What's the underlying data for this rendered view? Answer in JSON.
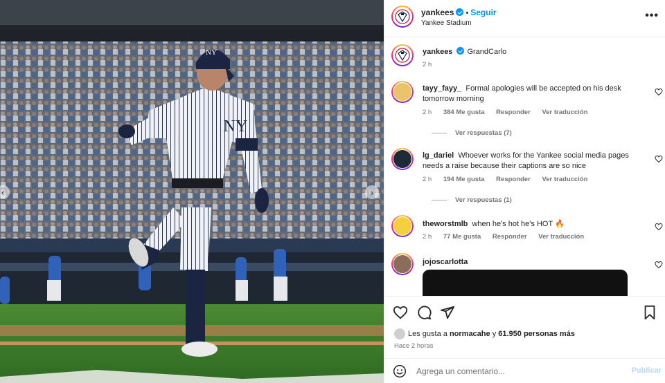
{
  "header": {
    "username": "yankees",
    "follow_label": "Seguir",
    "dot": "•",
    "location": "Yankee Stadium",
    "more_label": "•••"
  },
  "caption": {
    "username": "yankees",
    "text": "GrandCarlo",
    "time": "2 h"
  },
  "comments": [
    {
      "username": "tayy_fayy_",
      "text": "Formal apologies will be accepted on his desk tomorrow morning",
      "time": "2 h",
      "likes": "384 Me gusta",
      "reply": "Responder",
      "translate": "Ver traducción",
      "view_replies": "Ver respuestas (7)"
    },
    {
      "username": "lg_dariel",
      "text": "Whoever works for the Yankee social media pages needs a raise because their captions are so nice",
      "time": "2 h",
      "likes": "194 Me gusta",
      "reply": "Responder",
      "translate": "Ver traducción",
      "view_replies": "Ver respuestas (1)"
    },
    {
      "username": "theworstmlb",
      "text": "when he's hot he's HOT 🔥",
      "time": "2 h",
      "likes": "77 Me gusta",
      "reply": "Responder",
      "translate": "Ver traducción"
    },
    {
      "username": "jojoscarlotta",
      "text": ""
    }
  ],
  "likes_summary": {
    "prefix": "Les gusta a",
    "user": "normacahe",
    "middle": "y",
    "others": "61.950 personas más"
  },
  "posted": "Hace 2 horas",
  "composer": {
    "placeholder": "Agrega un comentario...",
    "publish_label": "Publicar"
  },
  "icons": {
    "like": "heart-icon",
    "comment": "comment-icon",
    "share": "share-icon",
    "save": "bookmark-icon",
    "emoji": "emoji-icon",
    "more": "more-icon"
  },
  "colors": {
    "accent": "#0095f6",
    "publish_disabled": "#b3dbff",
    "secondary_text": "#737373"
  }
}
